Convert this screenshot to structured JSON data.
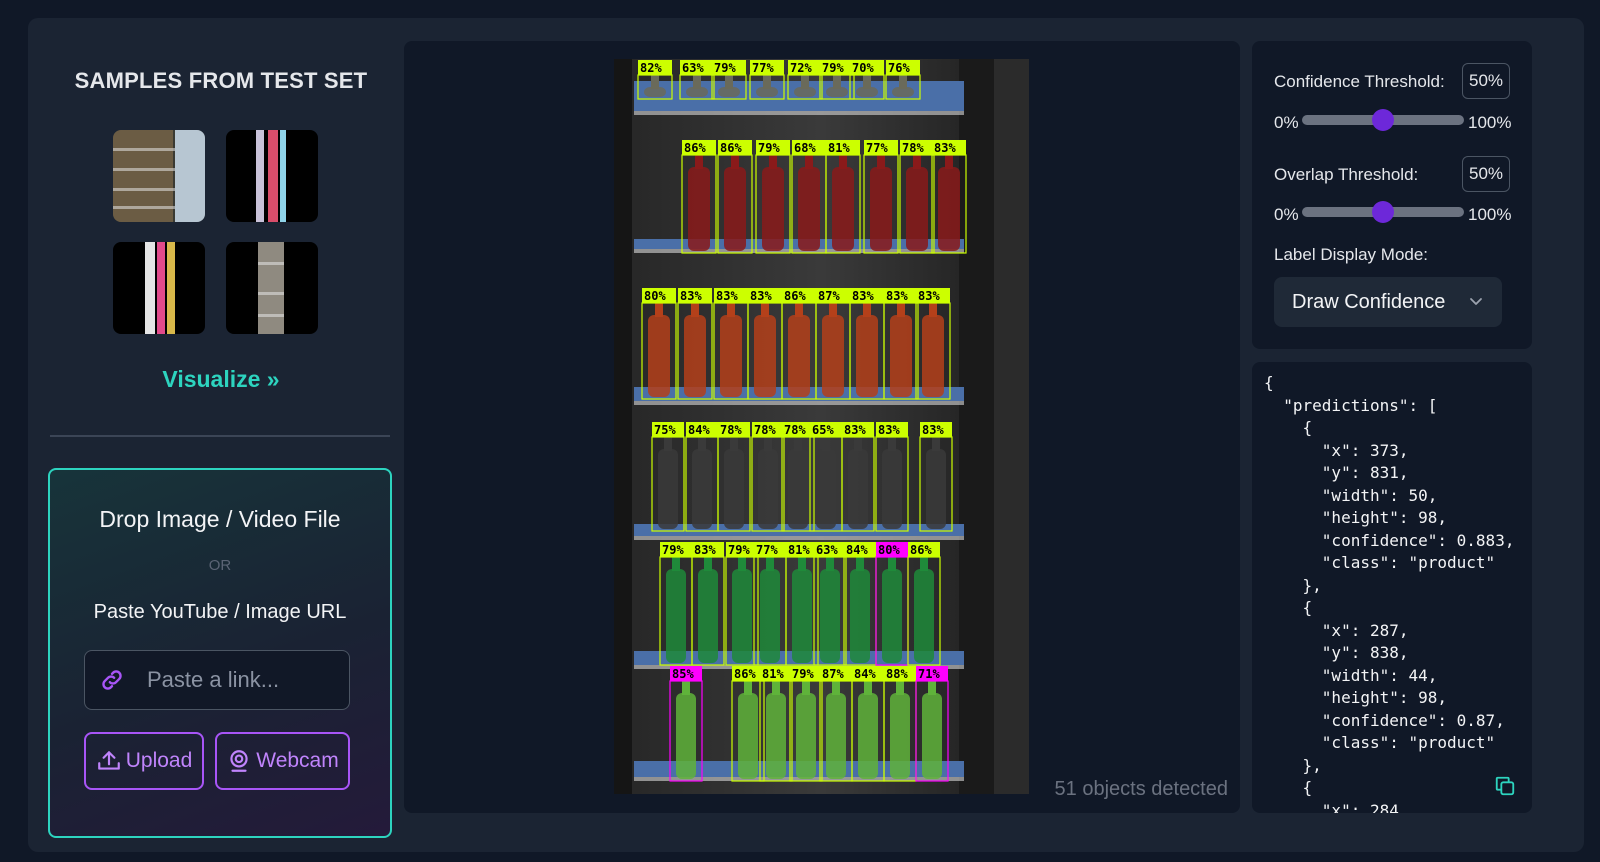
{
  "sidebar": {
    "samples_title": "SAMPLES FROM TEST SET",
    "visualize_label": "Visualize »",
    "drop_title": "Drop Image / Video File",
    "or_label": "OR",
    "paste_label": "Paste YouTube / Image URL",
    "link_placeholder": "Paste a link...",
    "upload_label": "Upload",
    "webcam_label": "Webcam"
  },
  "viewer": {
    "objects_detected": "51 objects detected",
    "detections": [
      {
        "label": "82%",
        "color": "#ccff00"
      },
      {
        "label": "63%",
        "color": "#ccff00"
      },
      {
        "label": "79%",
        "color": "#ccff00"
      },
      {
        "label": "77%",
        "color": "#ccff00"
      },
      {
        "label": "72%",
        "color": "#ccff00"
      },
      {
        "label": "79%",
        "color": "#ccff00"
      },
      {
        "label": "70%",
        "color": "#ccff00"
      },
      {
        "label": "76%",
        "color": "#ccff00"
      },
      {
        "label": "86%",
        "color": "#ccff00"
      },
      {
        "label": "86%",
        "color": "#ccff00"
      },
      {
        "label": "79%",
        "color": "#ccff00"
      },
      {
        "label": "68%",
        "color": "#ccff00"
      },
      {
        "label": "81%",
        "color": "#ccff00"
      },
      {
        "label": "77%",
        "color": "#ccff00"
      },
      {
        "label": "78%",
        "color": "#ccff00"
      },
      {
        "label": "83%",
        "color": "#ccff00"
      },
      {
        "label": "80%",
        "color": "#ccff00"
      },
      {
        "label": "83%",
        "color": "#ccff00"
      },
      {
        "label": "83%",
        "color": "#ccff00"
      },
      {
        "label": "83%",
        "color": "#ccff00"
      },
      {
        "label": "86%",
        "color": "#ccff00"
      },
      {
        "label": "87%",
        "color": "#ccff00"
      },
      {
        "label": "83%",
        "color": "#ccff00"
      },
      {
        "label": "83%",
        "color": "#ccff00"
      },
      {
        "label": "83%",
        "color": "#ccff00"
      },
      {
        "label": "75%",
        "color": "#ccff00"
      },
      {
        "label": "84%",
        "color": "#ccff00"
      },
      {
        "label": "78%",
        "color": "#ccff00"
      },
      {
        "label": "78%",
        "color": "#ccff00"
      },
      {
        "label": "78%",
        "color": "#ccff00"
      },
      {
        "label": "65%",
        "color": "#ccff00"
      },
      {
        "label": "83%",
        "color": "#ccff00"
      },
      {
        "label": "83%",
        "color": "#ccff00"
      },
      {
        "label": "83%",
        "color": "#ccff00"
      },
      {
        "label": "79%",
        "color": "#ccff00"
      },
      {
        "label": "83%",
        "color": "#ccff00"
      },
      {
        "label": "79%",
        "color": "#ccff00"
      },
      {
        "label": "77%",
        "color": "#ccff00"
      },
      {
        "label": "81%",
        "color": "#ccff00"
      },
      {
        "label": "63%",
        "color": "#ccff00"
      },
      {
        "label": "84%",
        "color": "#ccff00"
      },
      {
        "label": "80%",
        "color": "#ff00ff"
      },
      {
        "label": "86%",
        "color": "#ccff00"
      },
      {
        "label": "85%",
        "color": "#ff00ff"
      },
      {
        "label": "86%",
        "color": "#ccff00"
      },
      {
        "label": "81%",
        "color": "#ccff00"
      },
      {
        "label": "79%",
        "color": "#ccff00"
      },
      {
        "label": "87%",
        "color": "#ccff00"
      },
      {
        "label": "84%",
        "color": "#ccff00"
      },
      {
        "label": "88%",
        "color": "#ccff00"
      },
      {
        "label": "71%",
        "color": "#ff00ff"
      }
    ]
  },
  "controls": {
    "confidence_label": "Confidence Threshold:",
    "confidence_value": "50%",
    "confidence_fraction": 0.5,
    "overlap_label": "Overlap Threshold:",
    "overlap_value": "50%",
    "overlap_fraction": 0.5,
    "range_min": "0%",
    "range_max": "100%",
    "label_mode_label": "Label Display Mode:",
    "label_mode_value": "Draw Confidence"
  },
  "json_output": "{\n  \"predictions\": [\n    {\n      \"x\": 373,\n      \"y\": 831,\n      \"width\": 50,\n      \"height\": 98,\n      \"confidence\": 0.883,\n      \"class\": \"product\"\n    },\n    {\n      \"x\": 287,\n      \"y\": 838,\n      \"width\": 44,\n      \"height\": 98,\n      \"confidence\": 0.87,\n      \"class\": \"product\"\n    },\n    {\n      \"x\": 284,",
  "colors": {
    "accent_teal": "#2dd4bf",
    "accent_purple": "#a855f7",
    "slider_knob": "#6d28d9",
    "detection_box": "#ccff00",
    "detection_box_alt": "#ff00ff"
  },
  "icons": [
    "link-icon",
    "upload-icon",
    "webcam-icon",
    "chevron-down-icon",
    "copy-icon"
  ]
}
